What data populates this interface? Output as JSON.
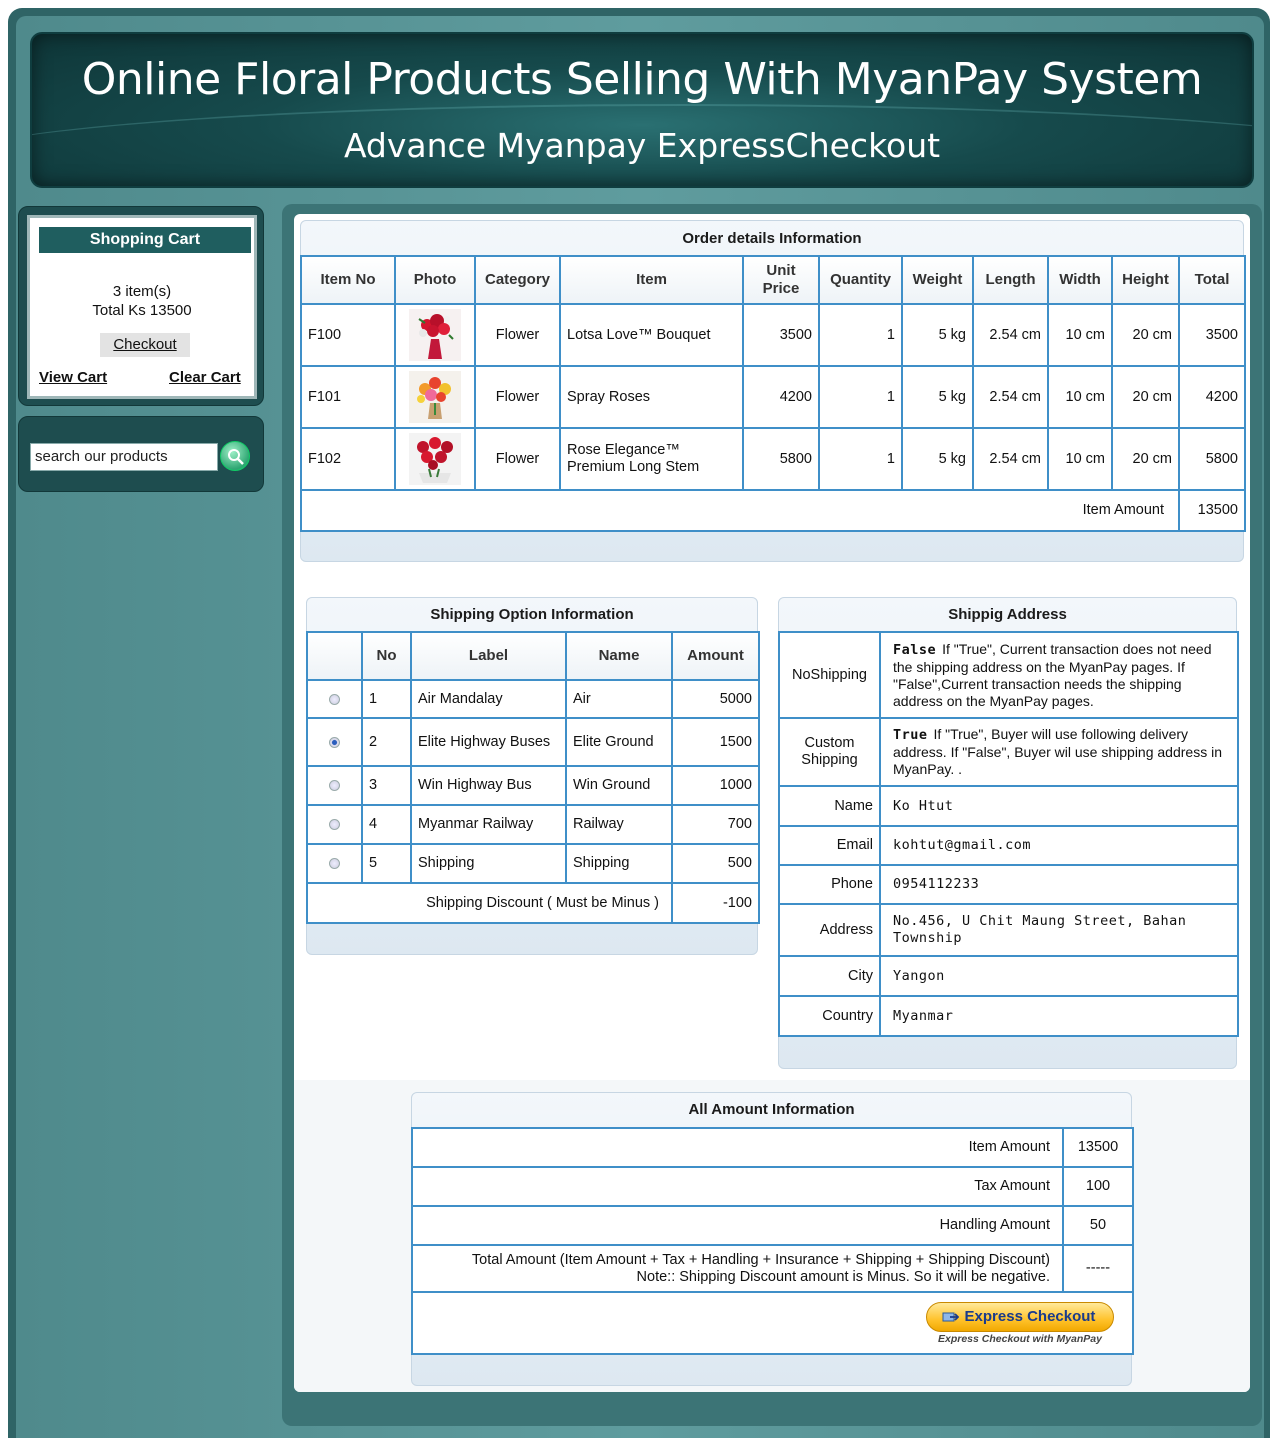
{
  "header": {
    "title": "Online Floral Products Selling With MyanPay System",
    "subtitle": "Advance Myanpay ExpressCheckout"
  },
  "cart": {
    "title": "Shopping Cart",
    "items": "3 item(s)",
    "total": "Total Ks 13500",
    "checkout": "Checkout",
    "view_cart": "View Cart",
    "clear_cart": "Clear Cart"
  },
  "search": {
    "placeholder": "search our products",
    "icon": "search-icon"
  },
  "order": {
    "title": "Order details Information",
    "headers": [
      "Item No",
      "Photo",
      "Category",
      "Item",
      "Unit Price",
      "Quantity",
      "Weight",
      "Length",
      "Width",
      "Height",
      "Total"
    ],
    "rows": [
      {
        "no": "F100",
        "category": "Flower",
        "item": "Lotsa Love™ Bouquet",
        "price": "3500",
        "qty": "1",
        "weight": "5 kg",
        "length": "2.54 cm",
        "width": "10 cm",
        "height": "20 cm",
        "total": "3500",
        "photo": "red-bouquet"
      },
      {
        "no": "F101",
        "category": "Flower",
        "item": "Spray Roses",
        "price": "4200",
        "qty": "1",
        "weight": "5 kg",
        "length": "2.54 cm",
        "width": "10 cm",
        "height": "20 cm",
        "total": "4200",
        "photo": "mixed-roses"
      },
      {
        "no": "F102",
        "category": "Flower",
        "item": "Rose Elegance™ Premium Long Stem",
        "price": "5800",
        "qty": "1",
        "weight": "5 kg",
        "length": "2.54 cm",
        "width": "10 cm",
        "height": "20 cm",
        "total": "5800",
        "photo": "red-roses"
      }
    ],
    "item_amount_label": "Item Amount",
    "item_amount": "13500"
  },
  "shipping_options": {
    "title": "Shipping Option Information",
    "headers": [
      "",
      "No",
      "Label",
      "Name",
      "Amount"
    ],
    "rows": [
      {
        "no": "1",
        "label": "Air Mandalay",
        "name": "Air",
        "amount": "5000",
        "selected": false
      },
      {
        "no": "2",
        "label": "Elite Highway Buses",
        "name": "Elite Ground",
        "amount": "1500",
        "selected": true
      },
      {
        "no": "3",
        "label": "Win Highway Bus",
        "name": "Win Ground",
        "amount": "1000",
        "selected": false
      },
      {
        "no": "4",
        "label": "Myanmar Railway",
        "name": "Railway",
        "amount": "700",
        "selected": false
      },
      {
        "no": "5",
        "label": "Shipping",
        "name": "Shipping",
        "amount": "500",
        "selected": false
      }
    ],
    "discount_label": "Shipping Discount ( Must be Minus )",
    "discount": "-100"
  },
  "shipping_address": {
    "title": "Shippig Address",
    "noshipping_label": "NoShipping",
    "noshipping_value": "False",
    "noshipping_desc": "If \"True\", Current transaction does not need the shipping address on the MyanPay pages. If \"False\",Current transaction needs the shipping address on the MyanPay pages.",
    "custom_label": "Custom Shipping",
    "custom_value": "True",
    "custom_desc": "If \"True\", Buyer will use following delivery address. If \"False\", Buyer wil use shipping address in MyanPay. .",
    "fields": [
      {
        "label": "Name",
        "value": "Ko Htut"
      },
      {
        "label": "Email",
        "value": "kohtut@gmail.com"
      },
      {
        "label": "Phone",
        "value": "0954112233"
      },
      {
        "label": "Address",
        "value": "No.456, U Chit Maung Street, Bahan Township"
      },
      {
        "label": "City",
        "value": "Yangon"
      },
      {
        "label": "Country",
        "value": "Myanmar"
      }
    ]
  },
  "amounts": {
    "title": "All Amount Information",
    "rows": [
      {
        "label": "Item Amount",
        "value": "13500"
      },
      {
        "label": "Tax Amount",
        "value": "100"
      },
      {
        "label": "Handling Amount",
        "value": "50"
      }
    ],
    "total_label": "Total Amount (Item Amount + Tax + Handling + Insurance + Shipping + Shipping Discount)",
    "total_note": "Note:: Shipping Discount amount is Minus. So it will be negative.",
    "total_value": "-----",
    "express_button": "Express Checkout",
    "express_caption": "Express Checkout with MyanPay"
  },
  "colors": {
    "frame": "#2f6466",
    "header": "#164a4c",
    "table_border": "#3f8fc8",
    "cart_title": "#1f5e5f",
    "button": "#ffc22b"
  }
}
